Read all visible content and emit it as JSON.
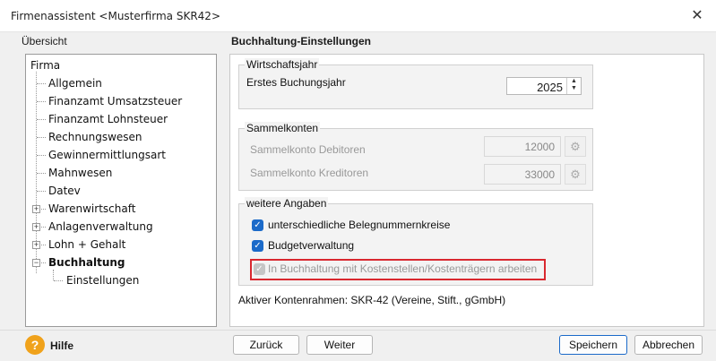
{
  "window": {
    "title": "Firmenassistent <Musterfirma SKR42>",
    "close_glyph": "✕"
  },
  "overview": {
    "heading": "Übersicht",
    "tree": [
      {
        "label": "Firma"
      },
      {
        "label": "Allgemein"
      },
      {
        "label": "Finanzamt Umsatzsteuer"
      },
      {
        "label": "Finanzamt Lohnsteuer"
      },
      {
        "label": "Rechnungswesen"
      },
      {
        "label": "Gewinnermittlungsart"
      },
      {
        "label": "Mahnwesen"
      },
      {
        "label": "Datev"
      },
      {
        "label": "Warenwirtschaft",
        "expander": "+"
      },
      {
        "label": "Anlagenverwaltung",
        "expander": "+"
      },
      {
        "label": "Lohn + Gehalt",
        "expander": "+"
      },
      {
        "label": "Buchhaltung",
        "expander": "−",
        "selected": true
      },
      {
        "label": "Einstellungen"
      }
    ]
  },
  "settings": {
    "heading": "Buchhaltung-Einstellungen",
    "fiscal_year": {
      "group": "Wirtschaftsjahr",
      "label": "Erstes Buchungsjahr",
      "value": "2025"
    },
    "collective_accounts": {
      "group": "Sammelkonten",
      "debitoren_label": "Sammelkonto Debitoren",
      "debitoren_value": "12000",
      "kreditoren_label": "Sammelkonto Kreditoren",
      "kreditoren_value": "33000"
    },
    "more": {
      "group": "weitere Angaben",
      "options": [
        {
          "label": "unterschiedliche Belegnummernkreise",
          "checked": true,
          "enabled": true
        },
        {
          "label": "Budgetverwaltung",
          "checked": true,
          "enabled": true
        },
        {
          "label": "In Buchhaltung mit Kostenstellen/Kostenträgern arbeiten",
          "checked": true,
          "enabled": false,
          "highlighted": true
        }
      ]
    },
    "chart_of_accounts": "Aktiver Kontenrahmen: SKR-42 (Vereine, Stift., gGmbH)"
  },
  "footer": {
    "help_glyph": "?",
    "help_label": "Hilfe",
    "back_label": "Zurück",
    "next_label": "Weiter",
    "save_label": "Speichern",
    "cancel_label": "Abbrechen"
  },
  "colors": {
    "accent": "#1b6ac9",
    "highlight_border": "#d9282f",
    "help_icon": "#f0a21b"
  }
}
